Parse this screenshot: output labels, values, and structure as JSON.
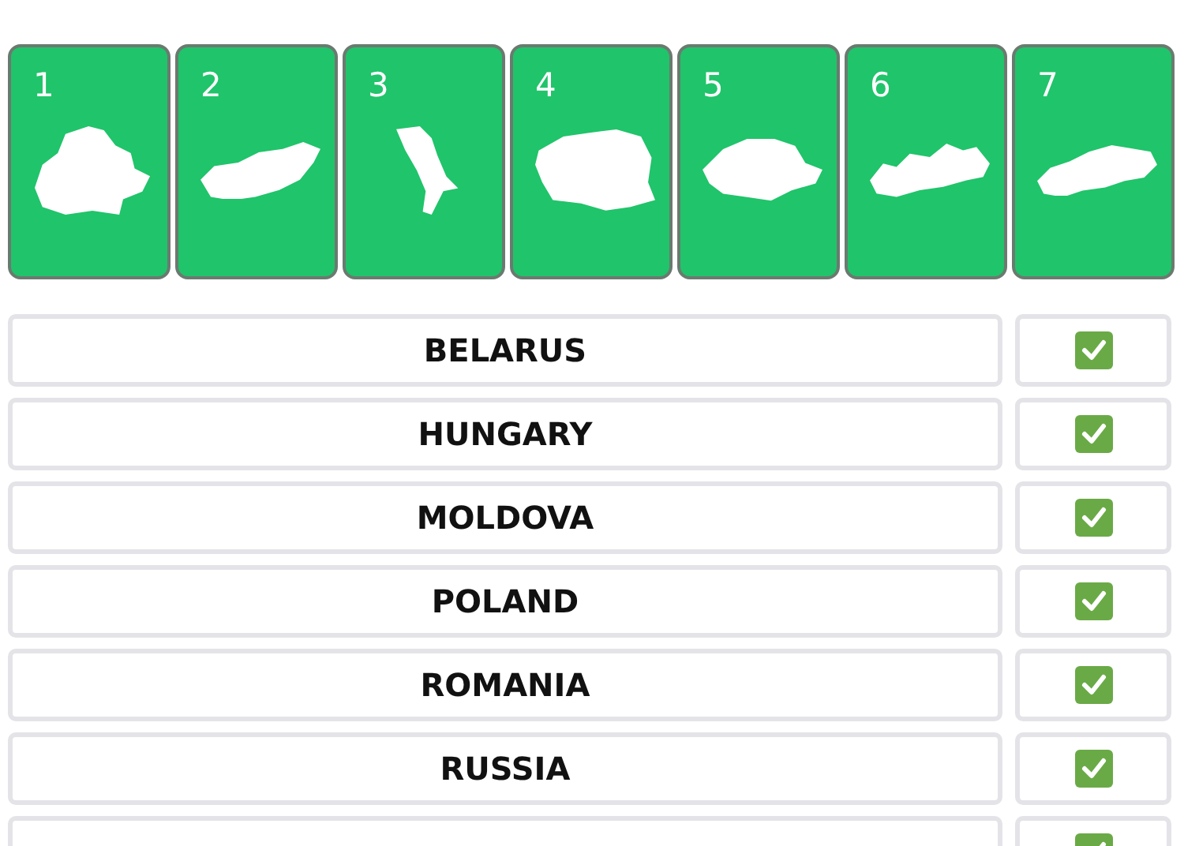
{
  "cards": [
    {
      "number": "1"
    },
    {
      "number": "2"
    },
    {
      "number": "3"
    },
    {
      "number": "4"
    },
    {
      "number": "5"
    },
    {
      "number": "6"
    },
    {
      "number": "7"
    }
  ],
  "answers": [
    {
      "country": "BELARUS",
      "correct": true
    },
    {
      "country": "HUNGARY",
      "correct": true
    },
    {
      "country": "MOLDOVA",
      "correct": true
    },
    {
      "country": "POLAND",
      "correct": true
    },
    {
      "country": "ROMANIA",
      "correct": true
    },
    {
      "country": "RUSSIA",
      "correct": true
    },
    {
      "correct": true
    }
  ]
}
